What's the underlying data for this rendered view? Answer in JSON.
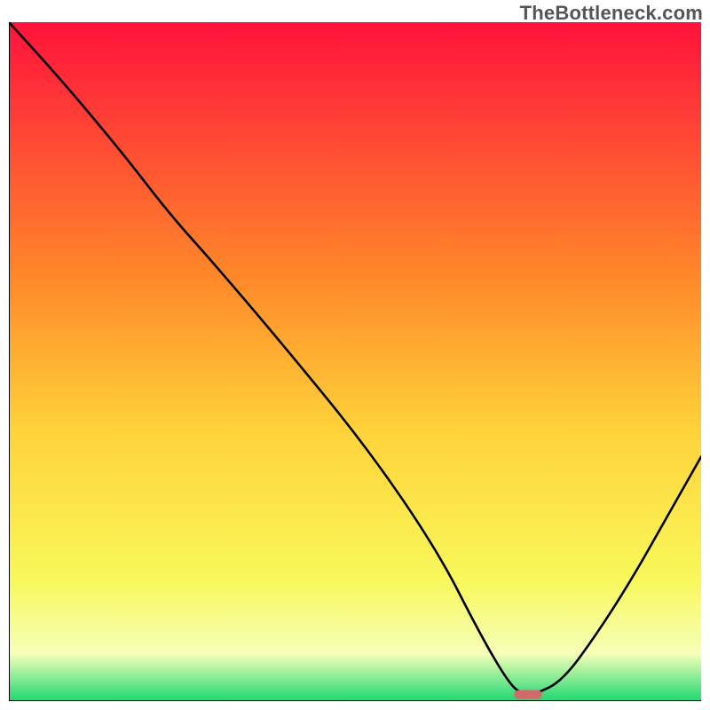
{
  "watermark": "TheBottleneck.com",
  "colors": {
    "watermark": "#555555",
    "axis": "#000000",
    "curve": "#000000",
    "marker_fill": "#d06a6a",
    "marker_filter": "rgba(208,106,106,0.5)",
    "grad_top": "#ff123c",
    "grad_mid_upper": "#ff8a2a",
    "grad_mid": "#ffd23a",
    "grad_mid_lower": "#f8f85a",
    "grad_pale": "#f6ffb8",
    "grad_bottom": "#1fd873"
  },
  "chart_data": {
    "type": "line",
    "title": "",
    "xlabel": "",
    "ylabel": "",
    "xlim": [
      0,
      100
    ],
    "ylim": [
      0,
      100
    ],
    "series": [
      {
        "name": "bottleneck-curve",
        "x": [
          0,
          8,
          17,
          23,
          30,
          40,
          52,
          62,
          68,
          72,
          74,
          76,
          80,
          85,
          90,
          95,
          100
        ],
        "values": [
          100,
          91,
          80,
          72,
          64,
          52,
          37,
          22,
          10,
          3,
          1,
          1,
          3,
          10,
          18,
          27,
          36
        ]
      }
    ],
    "marker": {
      "name": "optimal-point",
      "x": 75,
      "y": 1,
      "width_x": 4,
      "height_y": 1.2
    },
    "background_gradient_stops": [
      {
        "offset": 0,
        "color_key": "grad_top"
      },
      {
        "offset": 0.38,
        "color_key": "grad_mid_upper"
      },
      {
        "offset": 0.6,
        "color_key": "grad_mid"
      },
      {
        "offset": 0.82,
        "color_key": "grad_mid_lower"
      },
      {
        "offset": 0.93,
        "color_key": "grad_pale"
      },
      {
        "offset": 1.0,
        "color_key": "grad_bottom"
      }
    ]
  }
}
